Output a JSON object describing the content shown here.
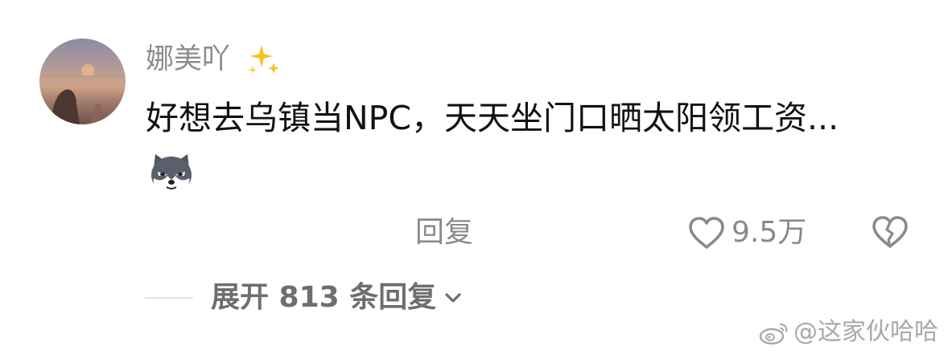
{
  "comment": {
    "username": "娜美吖",
    "text": "好想去乌镇当NPC，天天坐门口晒太阳领工资...",
    "avatar_icon": "user-avatar-sunset-photo",
    "badge_icon": "sparkles-emoji",
    "sticker_icon": "husky-dog-emoji"
  },
  "actions": {
    "reply_label": "回复",
    "like_count": "9.5万",
    "like_icon": "heart-outline-icon",
    "dislike_icon": "broken-heart-icon"
  },
  "replies": {
    "expand_label": "展开 813 条回复",
    "chevron_icon": "chevron-down-icon"
  },
  "watermark": {
    "text": "@这家伙哈哈",
    "icon": "weibo-logo-icon"
  },
  "colors": {
    "username": "#8b8b8b",
    "text": "#111111",
    "secondary": "#8a8a8a",
    "expand": "#6e6e6e",
    "watermark": "#a8a8a8"
  }
}
